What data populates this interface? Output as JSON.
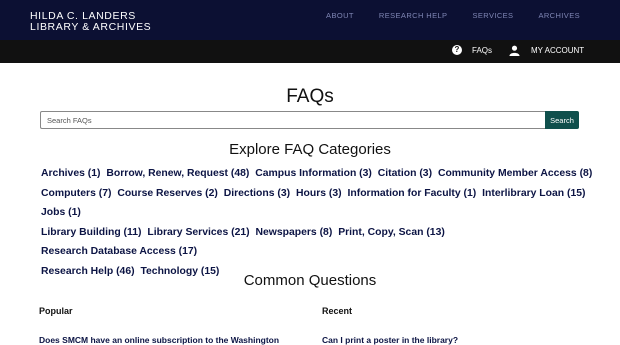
{
  "brand": {
    "line1": "HILDA C. LANDERS",
    "line2": "LIBRARY & ARCHIVES"
  },
  "top_nav": [
    {
      "label": "ABOUT"
    },
    {
      "label": "RESEARCH HELP"
    },
    {
      "label": "SERVICES"
    },
    {
      "label": "ARCHIVES"
    }
  ],
  "sub_nav": {
    "faqs_label": "FAQs",
    "account_label": "MY ACCOUNT"
  },
  "page_title": "FAQs",
  "search": {
    "placeholder": "Search FAQs",
    "button_label": "Search"
  },
  "explore_title": "Explore FAQ Categories",
  "categories": [
    "Archives (1)",
    "Borrow, Renew, Request (48)",
    "Campus Information (3)",
    "Citation (3)",
    "Community Member Access (8)",
    "Computers (7)",
    "Course Reserves (2)",
    "Directions (3)",
    "Hours (3)",
    "Information for Faculty (1)",
    "Interlibrary Loan (15)",
    "Jobs (1)",
    "Library Building (11)",
    "Library Services (21)",
    "Newspapers (8)",
    "Print, Copy, Scan (13)",
    "Research Database Access (17)",
    "Research Help (46)",
    "Technology (15)"
  ],
  "common": {
    "title": "Common Questions",
    "popular_label": "Popular",
    "recent_label": "Recent",
    "popular_first": "Does SMCM have an online subscription to the Washington",
    "recent_first": "Can I print a poster in the library?"
  },
  "colors": {
    "header_bg": "#0c1033",
    "subbar_bg": "#111111",
    "link": "#0c1444",
    "search_button": "#0f4f4c"
  }
}
